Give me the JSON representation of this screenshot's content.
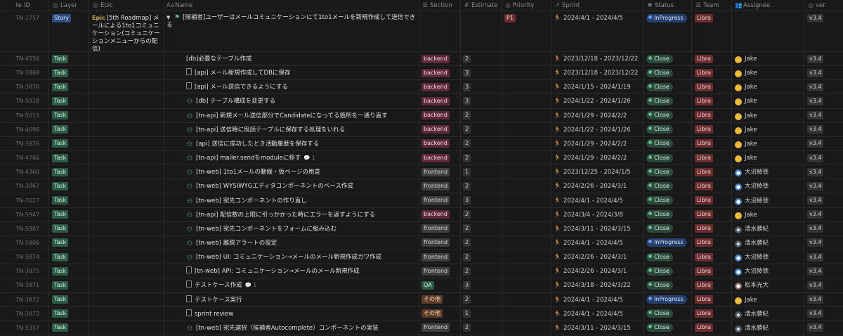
{
  "columns": [
    {
      "key": "id",
      "label": "ID",
      "icon": "№"
    },
    {
      "key": "layer",
      "label": "Layer",
      "icon": "◎"
    },
    {
      "key": "epic",
      "label": "Epic",
      "icon": "◎"
    },
    {
      "key": "name",
      "label": "Name",
      "icon": "Aa"
    },
    {
      "key": "section",
      "label": "Section",
      "icon": "☰"
    },
    {
      "key": "estimate",
      "label": "Estimate",
      "icon": "#"
    },
    {
      "key": "priority",
      "label": "Priority",
      "icon": "◎"
    },
    {
      "key": "sprint",
      "label": "Sprint",
      "icon": "↗"
    },
    {
      "key": "status",
      "label": "Status",
      "icon": "✺"
    },
    {
      "key": "team",
      "label": "Team",
      "icon": "☰"
    },
    {
      "key": "assignee",
      "label": "Assignee",
      "icon": "👥"
    },
    {
      "key": "ver",
      "label": "ver.",
      "icon": "◎"
    }
  ],
  "story": {
    "id": "TN-1757",
    "layer": "Story",
    "epic_prefix": "Epic",
    "epic": "[5th Roadmap] メールによる1to1コミュニケーション(コミュニケーションメニューからの配信)",
    "name": "[候補者]ユーザーはメールコミュニケーションにて1to1メールを新規作成して送信できる",
    "priority": "P1",
    "sprint": "2024/4/1 - 2024/4/5",
    "status": "InProgress",
    "team": "Libra",
    "ver": "v3.4"
  },
  "rows": [
    {
      "id": "TN-4556",
      "layer": "Task",
      "icon": "none",
      "name": "[db]必要なテーブル作成",
      "comments": "",
      "section": "backend",
      "estimate": "2",
      "sprint": "2023/12/18 - 2023/12/22",
      "status": "Close",
      "team": "Libra",
      "assignee": "Jake",
      "ver": "v3.4"
    },
    {
      "id": "TN-3869",
      "layer": "Task",
      "icon": "doc",
      "name": "[api] メール新規作成してDBに保存",
      "comments": "",
      "section": "backend",
      "estimate": "3",
      "sprint": "2023/12/18 - 2023/12/22",
      "status": "Close",
      "team": "Libra",
      "assignee": "Jake",
      "ver": "v3.4"
    },
    {
      "id": "TN-3870",
      "layer": "Task",
      "icon": "doc",
      "name": "[api] メール送信できるようにする",
      "comments": "",
      "section": "backend",
      "estimate": "3",
      "sprint": "2024/1/15 - 2024/1/19",
      "status": "Close",
      "team": "Libra",
      "assignee": "Jake",
      "ver": "v3.4"
    },
    {
      "id": "TN-5018",
      "layer": "Task",
      "icon": "emoji",
      "name": "[db] テーブル構成を変更する",
      "comments": "",
      "section": "backend",
      "estimate": "3",
      "sprint": "2024/1/22 - 2024/1/26",
      "status": "Close",
      "team": "Libra",
      "assignee": "Jake",
      "ver": "v3.4"
    },
    {
      "id": "TN-5015",
      "layer": "Task",
      "icon": "emoji",
      "name": "[tn-api] 新規メール送信部分でCandidateになってる箇所を一通り直す",
      "comments": "",
      "section": "backend",
      "estimate": "2",
      "sprint": "2024/1/29 - 2024/2/2",
      "status": "Close",
      "team": "Libra",
      "assignee": "Jake",
      "ver": "v3.4"
    },
    {
      "id": "TN-4696",
      "layer": "Task",
      "icon": "emoji",
      "name": "[tn-api] 送信時に既読テーブルに保存する処理をいれる",
      "comments": "",
      "section": "backend",
      "estimate": "2",
      "sprint": "2024/1/22 - 2024/1/26",
      "status": "Close",
      "team": "Libra",
      "assignee": "Jake",
      "ver": "v3.4"
    },
    {
      "id": "TN-3876",
      "layer": "Task",
      "icon": "emoji",
      "name": "[api] 送信に成功したとき活動履歴を保存する",
      "comments": "",
      "section": "backend",
      "estimate": "2",
      "sprint": "2024/1/29 - 2024/2/2",
      "status": "Close",
      "team": "Libra",
      "assignee": "Jake",
      "ver": "v3.4"
    },
    {
      "id": "TN-4766",
      "layer": "Task",
      "icon": "emoji",
      "name": "[tn-api] mailer.sendをmoduleに移す",
      "comments": "1",
      "section": "backend",
      "estimate": "2",
      "sprint": "2024/1/29 - 2024/2/2",
      "status": "Close",
      "team": "Libra",
      "assignee": "Jake",
      "ver": "v3.4"
    },
    {
      "id": "TN-4360",
      "layer": "Task",
      "icon": "emoji",
      "name": "[tn-web] 1to1メールの動線・仮ページの用意",
      "comments": "",
      "section": "frontend",
      "estimate": "1",
      "sprint": "2023/12/25 - 2024/1/5",
      "status": "Close",
      "team": "Libra",
      "assignee": "大沼綾徳",
      "ver": "v3.4"
    },
    {
      "id": "TN-3867",
      "layer": "Task",
      "icon": "emoji",
      "name": "[tn-web] WYSIWYGエディタコンポーネントのベース作成",
      "comments": "",
      "section": "frontend",
      "estimate": "2",
      "sprint": "2024/2/26 - 2024/3/1",
      "status": "Close",
      "team": "Libra",
      "assignee": "大沼綾徳",
      "ver": "v3.4"
    },
    {
      "id": "TN-7027",
      "layer": "Task",
      "icon": "emoji",
      "name": "[tn-web] 宛先コンポーネントの作り直し",
      "comments": "",
      "section": "frontend",
      "estimate": "3",
      "sprint": "2024/4/1 - 2024/4/5",
      "status": "Close",
      "team": "Libra",
      "assignee": "大沼綾徳",
      "ver": "v3.4"
    },
    {
      "id": "TN-5947",
      "layer": "Task",
      "icon": "emoji",
      "name": "[tn-api] 配信数の上限に引っかかった時にエラーを返すようにする",
      "comments": "",
      "section": "backend",
      "estimate": "2",
      "sprint": "2024/3/4 - 2024/3/8",
      "status": "Close",
      "team": "Libra",
      "assignee": "Jake",
      "ver": "v3.4"
    },
    {
      "id": "TN-5807",
      "layer": "Task",
      "icon": "emoji",
      "name": "[tn-web] 宛先コンポーネントをフォームに組み込む",
      "comments": "",
      "section": "frontend",
      "estimate": "2",
      "sprint": "2024/3/11 - 2024/3/15",
      "status": "Close",
      "team": "Libra",
      "assignee": "清水勝紀",
      "ver": "v3.4"
    },
    {
      "id": "TN-5806",
      "layer": "Task",
      "icon": "emoji",
      "name": "[tn-web] 離脱アラートの設定",
      "comments": "",
      "section": "frontend",
      "estimate": "2",
      "sprint": "2024/4/1 - 2024/4/5",
      "status": "InProgress",
      "team": "Libra",
      "assignee": "清水勝紀",
      "ver": "v3.4"
    },
    {
      "id": "TN-3874",
      "layer": "Task",
      "icon": "emoji",
      "name": "[tn-web] UI: コミュニケーション→メールのメール新規作成ガワ作成",
      "comments": "",
      "section": "frontend",
      "estimate": "2",
      "sprint": "2024/2/26 - 2024/3/1",
      "status": "Close",
      "team": "Libra",
      "assignee": "大沼綾徳",
      "ver": "v3.4"
    },
    {
      "id": "TN-3875",
      "layer": "Task",
      "icon": "doc",
      "name": "[tn-web] API: コミュニケーション→メールのメール新規作成",
      "comments": "",
      "section": "frontend",
      "estimate": "2",
      "sprint": "2024/2/26 - 2024/3/1",
      "status": "Close",
      "team": "Libra",
      "assignee": "大沼綾徳",
      "ver": "v3.4"
    },
    {
      "id": "TN-3871",
      "layer": "Task",
      "icon": "doc",
      "name": "テストケース作成",
      "comments": "1",
      "section": "QA",
      "estimate": "3",
      "sprint": "2024/3/18 - 2024/3/22",
      "status": "Close",
      "team": "Libra",
      "assignee": "松本光大",
      "ver": "v3.4"
    },
    {
      "id": "TN-3872",
      "layer": "Task",
      "icon": "doc",
      "name": "テストケース実行",
      "comments": "",
      "section": "その他",
      "estimate": "2",
      "sprint": "2024/4/1 - 2024/4/5",
      "status": "InProgress",
      "team": "Libra",
      "assignee": "Jake",
      "ver": "v3.4"
    },
    {
      "id": "TN-3873",
      "layer": "Task",
      "icon": "doc",
      "name": "sprint review",
      "comments": "",
      "section": "その他",
      "estimate": "1",
      "sprint": "2024/4/1 - 2024/4/5",
      "status": "Close",
      "team": "Libra",
      "assignee": "清水勝紀",
      "ver": "v3.4"
    },
    {
      "id": "TN-5357",
      "layer": "Task",
      "icon": "emoji",
      "name": "[tn-web] 宛先選択（候補者Autocomplete）コンポーネントの実装",
      "comments": "",
      "section": "frontend",
      "estimate": "2",
      "sprint": "2024/3/11 - 2024/3/15",
      "status": "Close",
      "team": "Libra",
      "assignee": "清水勝紀",
      "ver": "v3.4"
    }
  ]
}
